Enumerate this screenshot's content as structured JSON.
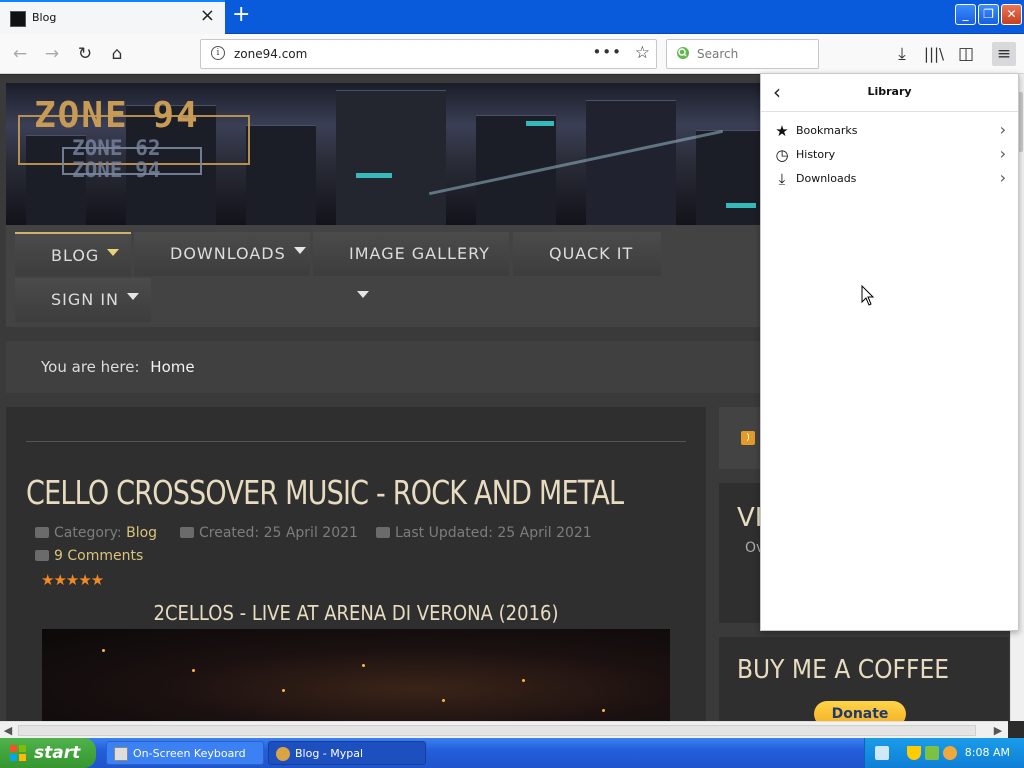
{
  "browser": {
    "tab_title": "Blog",
    "url": "zone94.com",
    "search_placeholder": "Search"
  },
  "site": {
    "logo_main": "ZONE 94",
    "logo_sub1": "ZONE 62",
    "logo_sub2": "ZONE 94",
    "menu": [
      {
        "label": "BLOG"
      },
      {
        "label": "DOWNLOADS"
      },
      {
        "label": "IMAGE GALLERY"
      },
      {
        "label": "QUACK IT"
      },
      {
        "label": "SIGN IN"
      }
    ],
    "breadcrumb_label": "You are here:",
    "breadcrumb_home": "Home"
  },
  "article": {
    "title": "CELLO CROSSOVER MUSIC - ROCK AND METAL",
    "category_label": "Category:",
    "category": "Blog",
    "created": "Created: 25 April 2021",
    "updated": "Last Updated: 25 April 2021",
    "comments": "9 Comments",
    "stars": "★★★★★",
    "video_title": "2CELLOS - LIVE AT ARENA DI VERONA (2016)"
  },
  "sidebar": {
    "partial_heading": "VI",
    "partial_text": "Ov",
    "coffee_title": "BUY ME A COFFEE",
    "donate_label": "Donate"
  },
  "library": {
    "title": "Library",
    "items": [
      {
        "label": "Bookmarks",
        "icon": "star-icon"
      },
      {
        "label": "History",
        "icon": "clock-icon"
      },
      {
        "label": "Downloads",
        "icon": "download-icon"
      }
    ]
  },
  "taskbar": {
    "start_label": "start",
    "tasks": [
      {
        "label": "On-Screen Keyboard"
      },
      {
        "label": "Blog - Mypal"
      }
    ],
    "clock": "8:08 AM"
  },
  "colors": {
    "accent": "#c9b46a",
    "title_text": "#e8dcc0",
    "link": "#d9c47a",
    "star": "#f08a24",
    "taskbar": "#245edb"
  }
}
